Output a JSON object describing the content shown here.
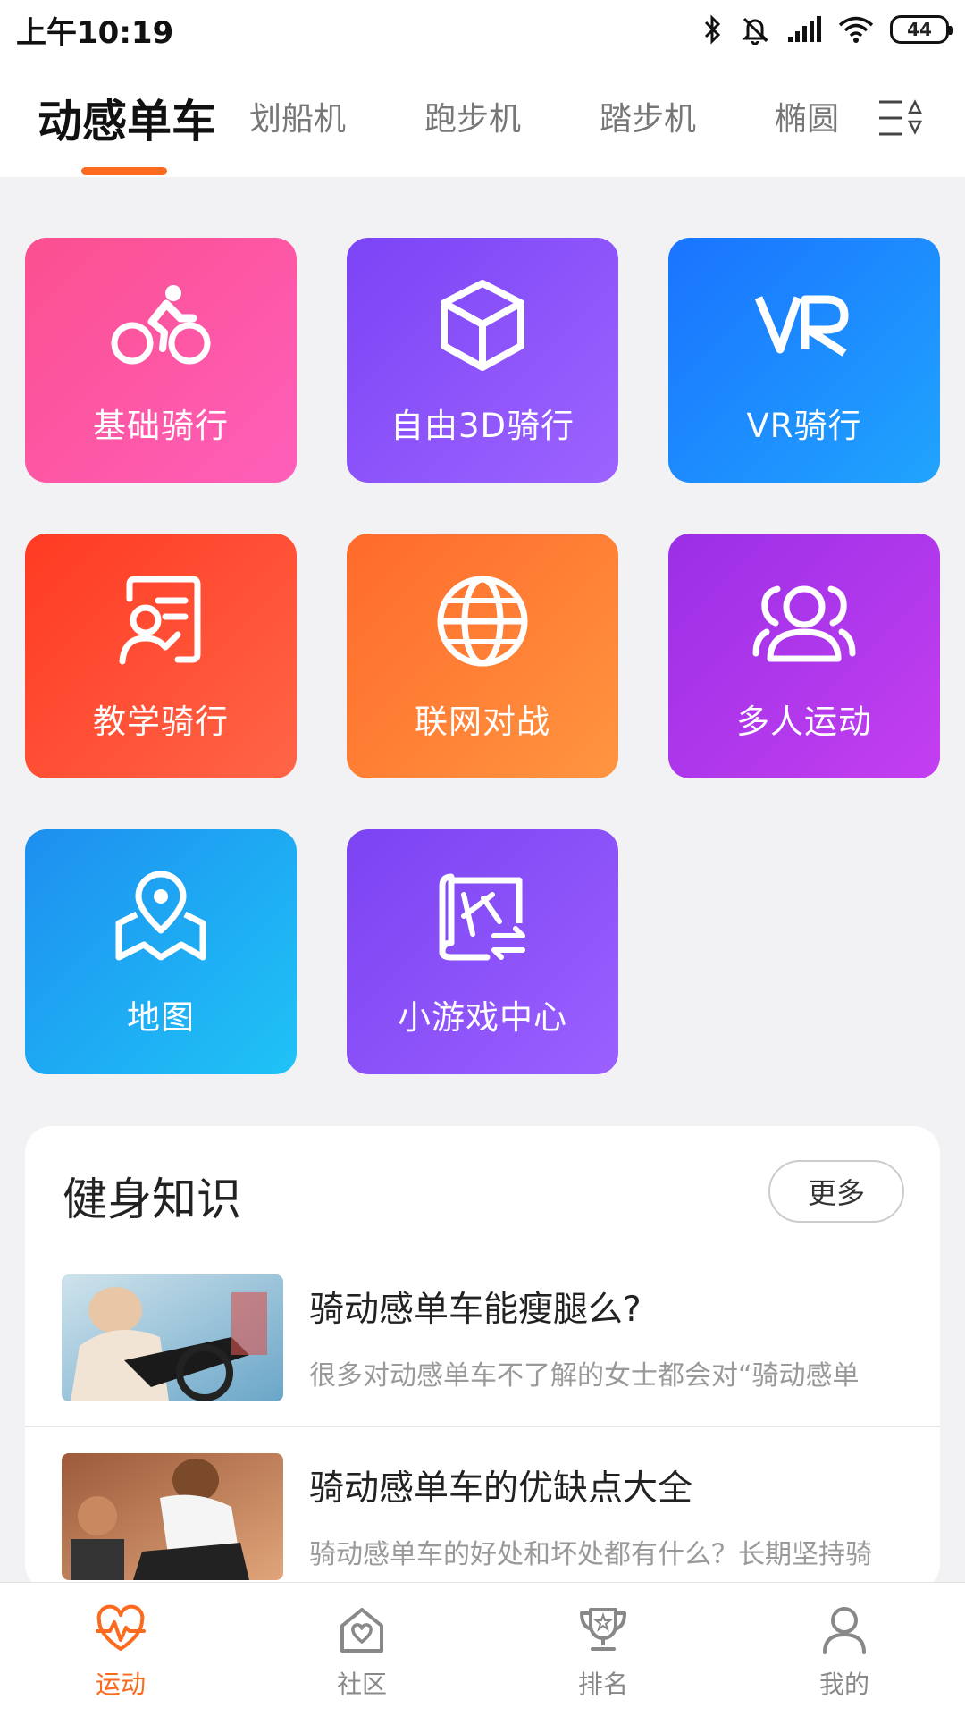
{
  "status_bar": {
    "time": "上午10:19",
    "battery": "44"
  },
  "tabs": [
    {
      "label": "动感单车",
      "active": true
    },
    {
      "label": "划船机",
      "active": false
    },
    {
      "label": "跑步机",
      "active": false
    },
    {
      "label": "踏步机",
      "active": false
    },
    {
      "label": "椭圆",
      "active": false
    }
  ],
  "tiles": [
    {
      "label": "基础骑行",
      "icon": "bicycle-icon",
      "gradient": [
        "#fb4f8f",
        "#ff5fba"
      ]
    },
    {
      "label": "自由3D骑行",
      "icon": "cube-icon",
      "gradient": [
        "#7b44f5",
        "#9d63ff"
      ]
    },
    {
      "label": "VR骑行",
      "icon": "vr-icon",
      "gradient": [
        "#1a73ff",
        "#20a4fd"
      ]
    },
    {
      "label": "教学骑行",
      "icon": "teacher-board-icon",
      "gradient": [
        "#ff3a23",
        "#ff6547"
      ]
    },
    {
      "label": "联网对战",
      "icon": "globe-icon",
      "gradient": [
        "#ff6a2b",
        "#ff9540"
      ]
    },
    {
      "label": "多人运动",
      "icon": "group-users-icon",
      "gradient": [
        "#9b2fe6",
        "#c33ff0"
      ]
    },
    {
      "label": "地图",
      "icon": "map-pin-icon",
      "gradient": [
        "#1e8ff0",
        "#1fc3f6"
      ]
    },
    {
      "label": "小游戏中心",
      "icon": "game-map-icon",
      "gradient": [
        "#7b43f2",
        "#9b60ff"
      ]
    }
  ],
  "knowledge": {
    "title": "健身知识",
    "more": "更多",
    "articles": [
      {
        "title": "骑动感单车能瘦腿么?",
        "summary": "很多对动感单车不了解的女士都会对“骑动感单"
      },
      {
        "title": "骑动感单车的优缺点大全",
        "summary": "骑动感单车的好处和坏处都有什么？长期坚持骑"
      }
    ]
  },
  "bottom_nav": [
    {
      "label": "运动",
      "icon": "heartbeat-icon",
      "active": true
    },
    {
      "label": "社区",
      "icon": "home-heart-icon",
      "active": false
    },
    {
      "label": "排名",
      "icon": "trophy-icon",
      "active": false
    },
    {
      "label": "我的",
      "icon": "user-icon",
      "active": false
    }
  ],
  "colors": {
    "accent": "#fb6a1e",
    "background": "#f2f2f4"
  }
}
